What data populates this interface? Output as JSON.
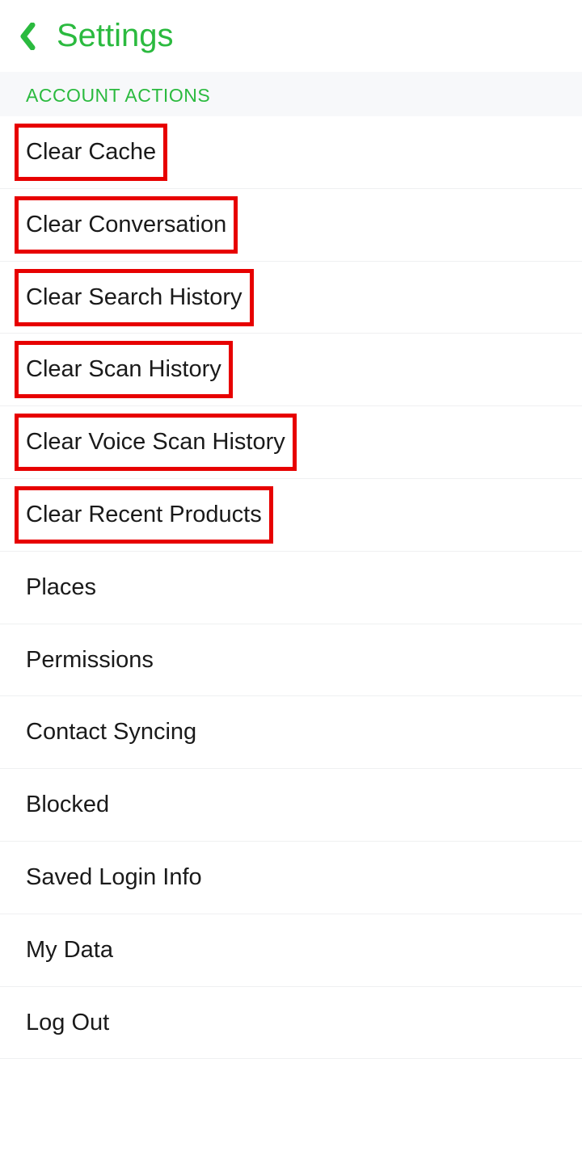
{
  "header": {
    "title": "Settings"
  },
  "section": {
    "title": "ACCOUNT ACTIONS"
  },
  "items": [
    {
      "label": "Clear Cache",
      "highlighted": true
    },
    {
      "label": "Clear Conversation",
      "highlighted": true
    },
    {
      "label": "Clear Search History",
      "highlighted": true
    },
    {
      "label": "Clear Scan History",
      "highlighted": true
    },
    {
      "label": "Clear Voice Scan History",
      "highlighted": true
    },
    {
      "label": "Clear Recent Products",
      "highlighted": true
    },
    {
      "label": "Places",
      "highlighted": false
    },
    {
      "label": "Permissions",
      "highlighted": false
    },
    {
      "label": "Contact Syncing",
      "highlighted": false
    },
    {
      "label": "Blocked",
      "highlighted": false
    },
    {
      "label": "Saved Login Info",
      "highlighted": false
    },
    {
      "label": "My Data",
      "highlighted": false
    },
    {
      "label": "Log Out",
      "highlighted": false
    }
  ]
}
